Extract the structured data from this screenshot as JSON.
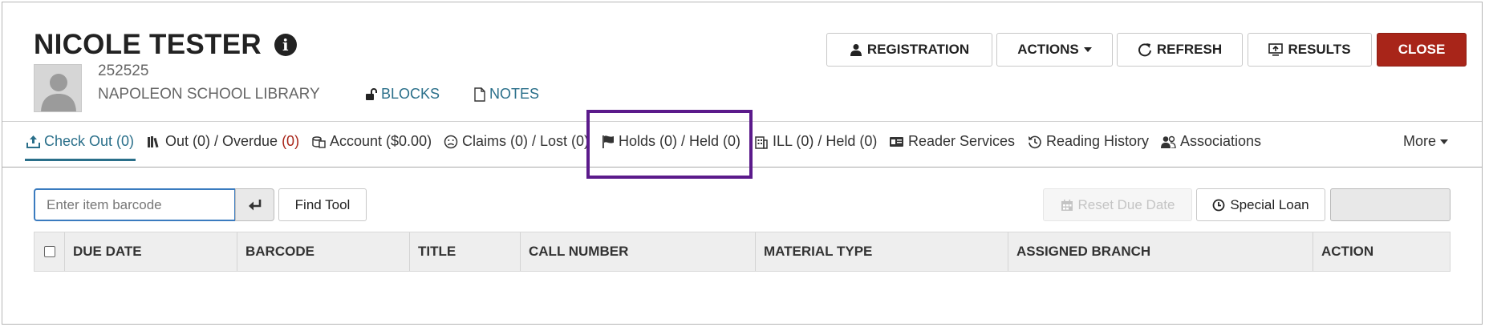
{
  "patron": {
    "name": "NICOLE TESTER",
    "barcode": "252525",
    "branch": "NAPOLEON SCHOOL LIBRARY",
    "blocks_label": "BLOCKS",
    "notes_label": "NOTES"
  },
  "header_buttons": {
    "registration": "REGISTRATION",
    "actions": "ACTIONS",
    "refresh": "REFRESH",
    "results": "RESULTS",
    "close": "CLOSE"
  },
  "tabs": {
    "checkout": "Check Out (0)",
    "out_prefix": "Out (0) / Overdue",
    "overdue_count": "(0)",
    "account": "Account ($0.00)",
    "claims": "Claims (0) / Lost (0)",
    "holds": "Holds (0) / Held (0)",
    "ill": "ILL (0) / Held (0)",
    "reader_services": "Reader Services",
    "reading_history": "Reading History",
    "associations": "Associations",
    "more": "More"
  },
  "toolbar": {
    "barcode_placeholder": "Enter item barcode",
    "find_tool": "Find Tool",
    "reset_due_date": "Reset Due Date",
    "special_loan": "Special Loan"
  },
  "table": {
    "columns": [
      "DUE DATE",
      "BARCODE",
      "TITLE",
      "CALL NUMBER",
      "MATERIAL TYPE",
      "ASSIGNED BRANCH",
      "ACTION"
    ]
  },
  "colors": {
    "accent": "#2a6f8a",
    "close_button": "#a82519",
    "highlight": "#5b1a8b"
  }
}
